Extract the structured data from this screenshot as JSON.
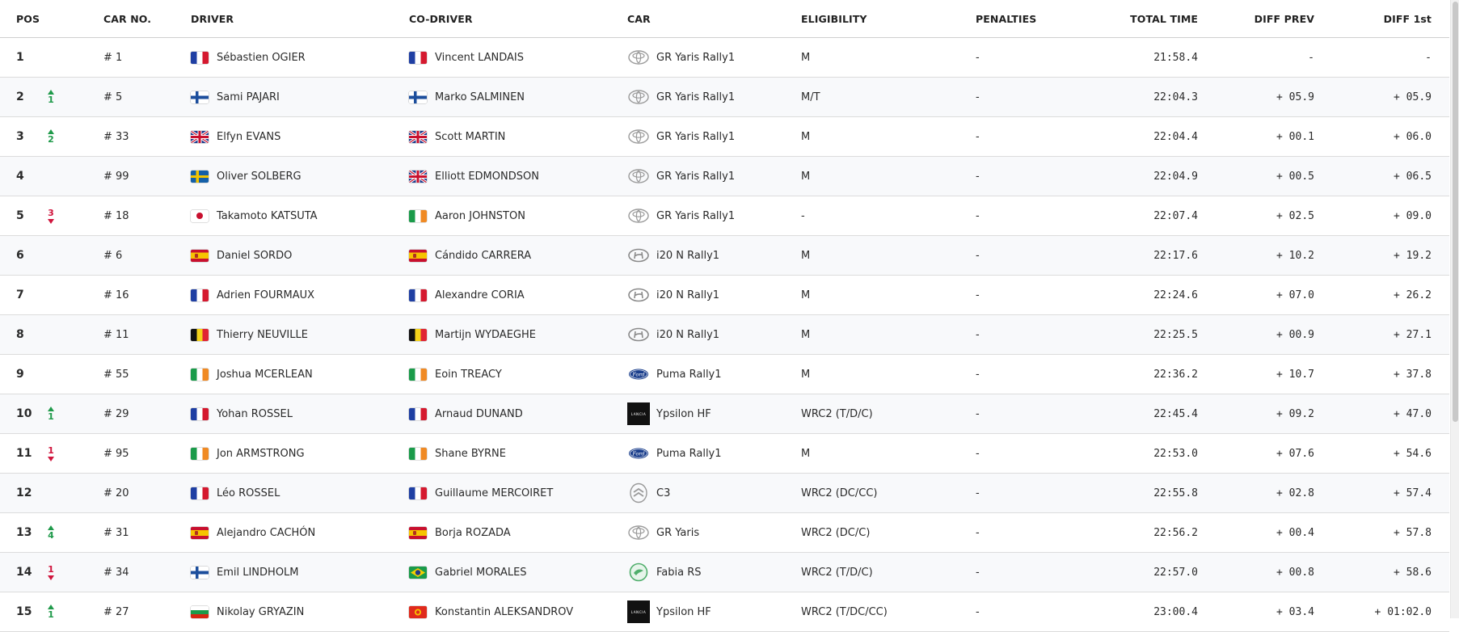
{
  "columns": {
    "pos": "POS",
    "car_no": "CAR No.",
    "driver": "DRIVER",
    "co_driver": "CO-DRIVER",
    "car": "CAR",
    "eligibility": "ELIGIBILITY",
    "penalties": "PENALTIES",
    "total_time": "TOTAL TIME",
    "diff_prev": "DIFF PREV",
    "diff_1st": "DIFF 1st"
  },
  "colors": {
    "up": "#1f9a4a",
    "down": "#d0143c"
  },
  "rows": [
    {
      "pos": "1",
      "change": null,
      "change_dir": null,
      "car_no": "# 1",
      "driver_flag": "FR",
      "driver": "Sébastien OGIER",
      "codriver_flag": "FR",
      "codriver": "Vincent LANDAIS",
      "car_logo": "toyota-logo",
      "car": "GR Yaris Rally1",
      "eligibility": "M",
      "penalties": "-",
      "total_time": "21:58.4",
      "diff_prev": "-",
      "diff_1st": "-"
    },
    {
      "pos": "2",
      "change": "1",
      "change_dir": "up",
      "car_no": "# 5",
      "driver_flag": "FI",
      "driver": "Sami PAJARI",
      "codriver_flag": "FI",
      "codriver": "Marko SALMINEN",
      "car_logo": "toyota-logo",
      "car": "GR Yaris Rally1",
      "eligibility": "M/T",
      "penalties": "-",
      "total_time": "22:04.3",
      "diff_prev": "+ 05.9",
      "diff_1st": "+ 05.9"
    },
    {
      "pos": "3",
      "change": "2",
      "change_dir": "up",
      "car_no": "# 33",
      "driver_flag": "GB",
      "driver": "Elfyn EVANS",
      "codriver_flag": "GB",
      "codriver": "Scott MARTIN",
      "car_logo": "toyota-logo",
      "car": "GR Yaris Rally1",
      "eligibility": "M",
      "penalties": "-",
      "total_time": "22:04.4",
      "diff_prev": "+ 00.1",
      "diff_1st": "+ 06.0"
    },
    {
      "pos": "4",
      "change": null,
      "change_dir": null,
      "car_no": "# 99",
      "driver_flag": "SE",
      "driver": "Oliver SOLBERG",
      "codriver_flag": "GB",
      "codriver": "Elliott EDMONDSON",
      "car_logo": "toyota-logo",
      "car": "GR Yaris Rally1",
      "eligibility": "M",
      "penalties": "-",
      "total_time": "22:04.9",
      "diff_prev": "+ 00.5",
      "diff_1st": "+ 06.5"
    },
    {
      "pos": "5",
      "change": "3",
      "change_dir": "down",
      "car_no": "# 18",
      "driver_flag": "JP",
      "driver": "Takamoto KATSUTA",
      "codriver_flag": "IE",
      "codriver": "Aaron JOHNSTON",
      "car_logo": "toyota-logo",
      "car": "GR Yaris Rally1",
      "eligibility": "-",
      "penalties": "-",
      "total_time": "22:07.4",
      "diff_prev": "+ 02.5",
      "diff_1st": "+ 09.0"
    },
    {
      "pos": "6",
      "change": null,
      "change_dir": null,
      "car_no": "# 6",
      "driver_flag": "ES",
      "driver": "Daniel SORDO",
      "codriver_flag": "ES",
      "codriver": "Cándido CARRERA",
      "car_logo": "hyundai-logo",
      "car": "i20 N Rally1",
      "eligibility": "M",
      "penalties": "-",
      "total_time": "22:17.6",
      "diff_prev": "+ 10.2",
      "diff_1st": "+ 19.2"
    },
    {
      "pos": "7",
      "change": null,
      "change_dir": null,
      "car_no": "# 16",
      "driver_flag": "FR",
      "driver": "Adrien FOURMAUX",
      "codriver_flag": "FR",
      "codriver": "Alexandre CORIA",
      "car_logo": "hyundai-logo",
      "car": "i20 N Rally1",
      "eligibility": "M",
      "penalties": "-",
      "total_time": "22:24.6",
      "diff_prev": "+ 07.0",
      "diff_1st": "+ 26.2"
    },
    {
      "pos": "8",
      "change": null,
      "change_dir": null,
      "car_no": "# 11",
      "driver_flag": "BE",
      "driver": "Thierry NEUVILLE",
      "codriver_flag": "BE",
      "codriver": "Martijn WYDAEGHE",
      "car_logo": "hyundai-logo",
      "car": "i20 N Rally1",
      "eligibility": "M",
      "penalties": "-",
      "total_time": "22:25.5",
      "diff_prev": "+ 00.9",
      "diff_1st": "+ 27.1"
    },
    {
      "pos": "9",
      "change": null,
      "change_dir": null,
      "car_no": "# 55",
      "driver_flag": "IE",
      "driver": "Joshua MCERLEAN",
      "codriver_flag": "IE",
      "codriver": "Eoin TREACY",
      "car_logo": "ford-logo",
      "car": "Puma Rally1",
      "eligibility": "M",
      "penalties": "-",
      "total_time": "22:36.2",
      "diff_prev": "+ 10.7",
      "diff_1st": "+ 37.8"
    },
    {
      "pos": "10",
      "change": "1",
      "change_dir": "up",
      "car_no": "# 29",
      "driver_flag": "FR",
      "driver": "Yohan ROSSEL",
      "codriver_flag": "FR",
      "codriver": "Arnaud DUNAND",
      "car_logo": "lancia-logo",
      "car": "Ypsilon HF",
      "eligibility": "WRC2 (T/D/C)",
      "penalties": "-",
      "total_time": "22:45.4",
      "diff_prev": "+ 09.2",
      "diff_1st": "+ 47.0"
    },
    {
      "pos": "11",
      "change": "1",
      "change_dir": "down",
      "car_no": "# 95",
      "driver_flag": "IE",
      "driver": "Jon ARMSTRONG",
      "codriver_flag": "IE",
      "codriver": "Shane BYRNE",
      "car_logo": "ford-logo",
      "car": "Puma Rally1",
      "eligibility": "M",
      "penalties": "-",
      "total_time": "22:53.0",
      "diff_prev": "+ 07.6",
      "diff_1st": "+ 54.6"
    },
    {
      "pos": "12",
      "change": null,
      "change_dir": null,
      "car_no": "# 20",
      "driver_flag": "FR",
      "driver": "Léo ROSSEL",
      "codriver_flag": "FR",
      "codriver": "Guillaume MERCOIRET",
      "car_logo": "citroen-logo",
      "car": "C3",
      "eligibility": "WRC2 (DC/CC)",
      "penalties": "-",
      "total_time": "22:55.8",
      "diff_prev": "+ 02.8",
      "diff_1st": "+ 57.4"
    },
    {
      "pos": "13",
      "change": "4",
      "change_dir": "up",
      "car_no": "# 31",
      "driver_flag": "ES",
      "driver": "Alejandro CACHÓN",
      "codriver_flag": "ES",
      "codriver": "Borja ROZADA",
      "car_logo": "toyota-logo",
      "car": "GR Yaris",
      "eligibility": "WRC2 (DC/C)",
      "penalties": "-",
      "total_time": "22:56.2",
      "diff_prev": "+ 00.4",
      "diff_1st": "+ 57.8"
    },
    {
      "pos": "14",
      "change": "1",
      "change_dir": "down",
      "car_no": "# 34",
      "driver_flag": "FI",
      "driver": "Emil LINDHOLM",
      "codriver_flag": "BR",
      "codriver": "Gabriel MORALES",
      "car_logo": "skoda-logo",
      "car": "Fabia RS",
      "eligibility": "WRC2 (T/D/C)",
      "penalties": "-",
      "total_time": "22:57.0",
      "diff_prev": "+ 00.8",
      "diff_1st": "+ 58.6"
    },
    {
      "pos": "15",
      "change": "1",
      "change_dir": "up",
      "car_no": "# 27",
      "driver_flag": "BG",
      "driver": "Nikolay GRYAZIN",
      "codriver_flag": "KG",
      "codriver": "Konstantin ALEKSANDROV",
      "car_logo": "lancia-logo",
      "car": "Ypsilon HF",
      "eligibility": "WRC2 (T/DC/CC)",
      "penalties": "-",
      "total_time": "23:00.4",
      "diff_prev": "+ 03.4",
      "diff_1st": "+ 01:02.0"
    }
  ]
}
